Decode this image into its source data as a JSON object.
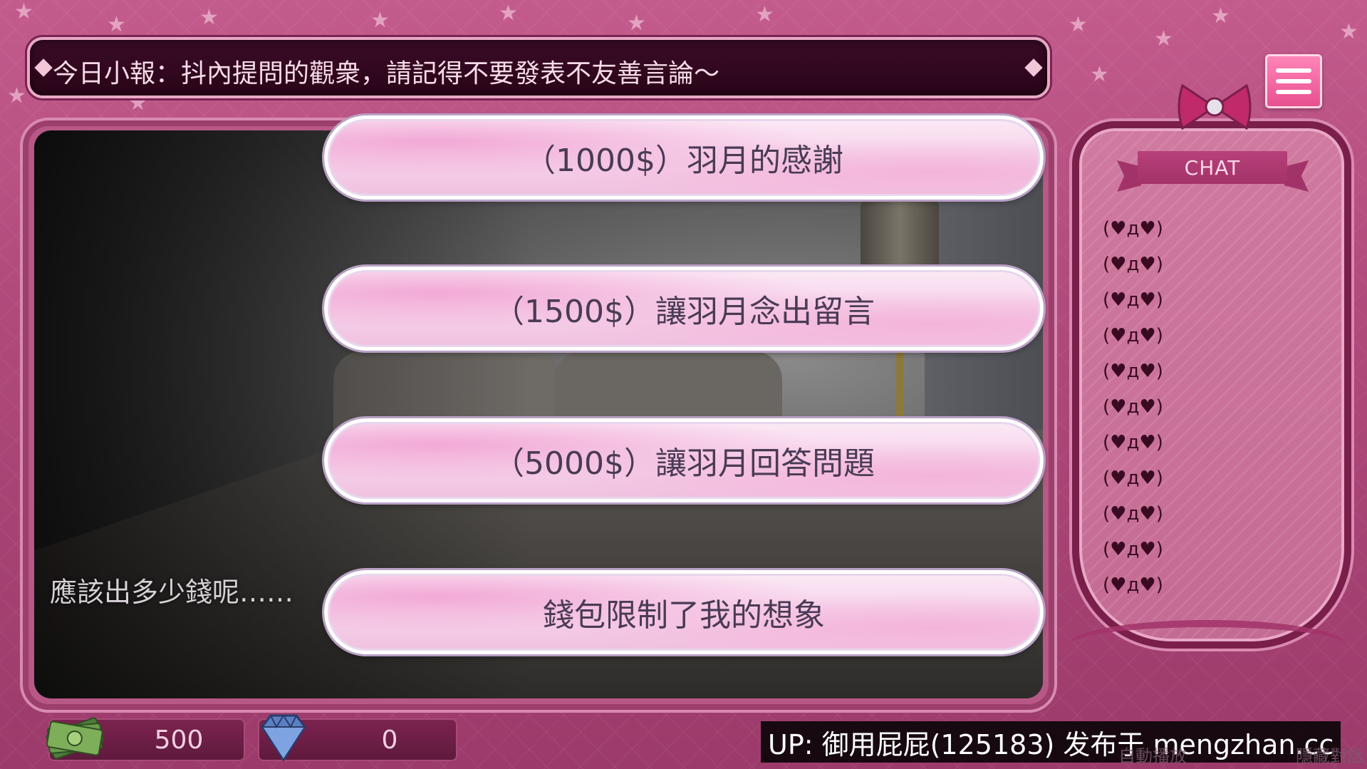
{
  "ticker": {
    "text": "今日小報：抖內提問的觀衆，請記得不要發表不友善言論～"
  },
  "menu": {
    "icon": "hamburger-menu-icon"
  },
  "scene": {
    "monologue": "應該出多少錢呢……"
  },
  "choices": [
    {
      "label": "（1000$）羽月的感謝"
    },
    {
      "label": "（1500$）讓羽月念出留言"
    },
    {
      "label": "（5000$）讓羽月回答問題"
    },
    {
      "label": "錢包限制了我的想象"
    }
  ],
  "chat": {
    "title": "CHAT",
    "lines": [
      "(♥д♥)",
      "(♥д♥)",
      "(♥д♥)",
      "(♥д♥)",
      "(♥д♥)",
      "(♥д♥)",
      "(♥д♥)",
      "(♥д♥)",
      "(♥д♥)",
      "(♥д♥)",
      "(♥д♥)"
    ]
  },
  "currency": {
    "money": "500",
    "gems": "0",
    "money_icon": "cash-icon",
    "gem_icon": "diamond-icon"
  },
  "watermark": {
    "text": "UP: 御用屁屁(125183) 发布于 mengzhan.cc"
  },
  "controls": {
    "auto_play": "自動播放",
    "hide_dialog": "隱藏對話"
  },
  "colors": {
    "accent": "#e8508f",
    "frame": "#7a1f4a",
    "background": "#b04a7b"
  }
}
